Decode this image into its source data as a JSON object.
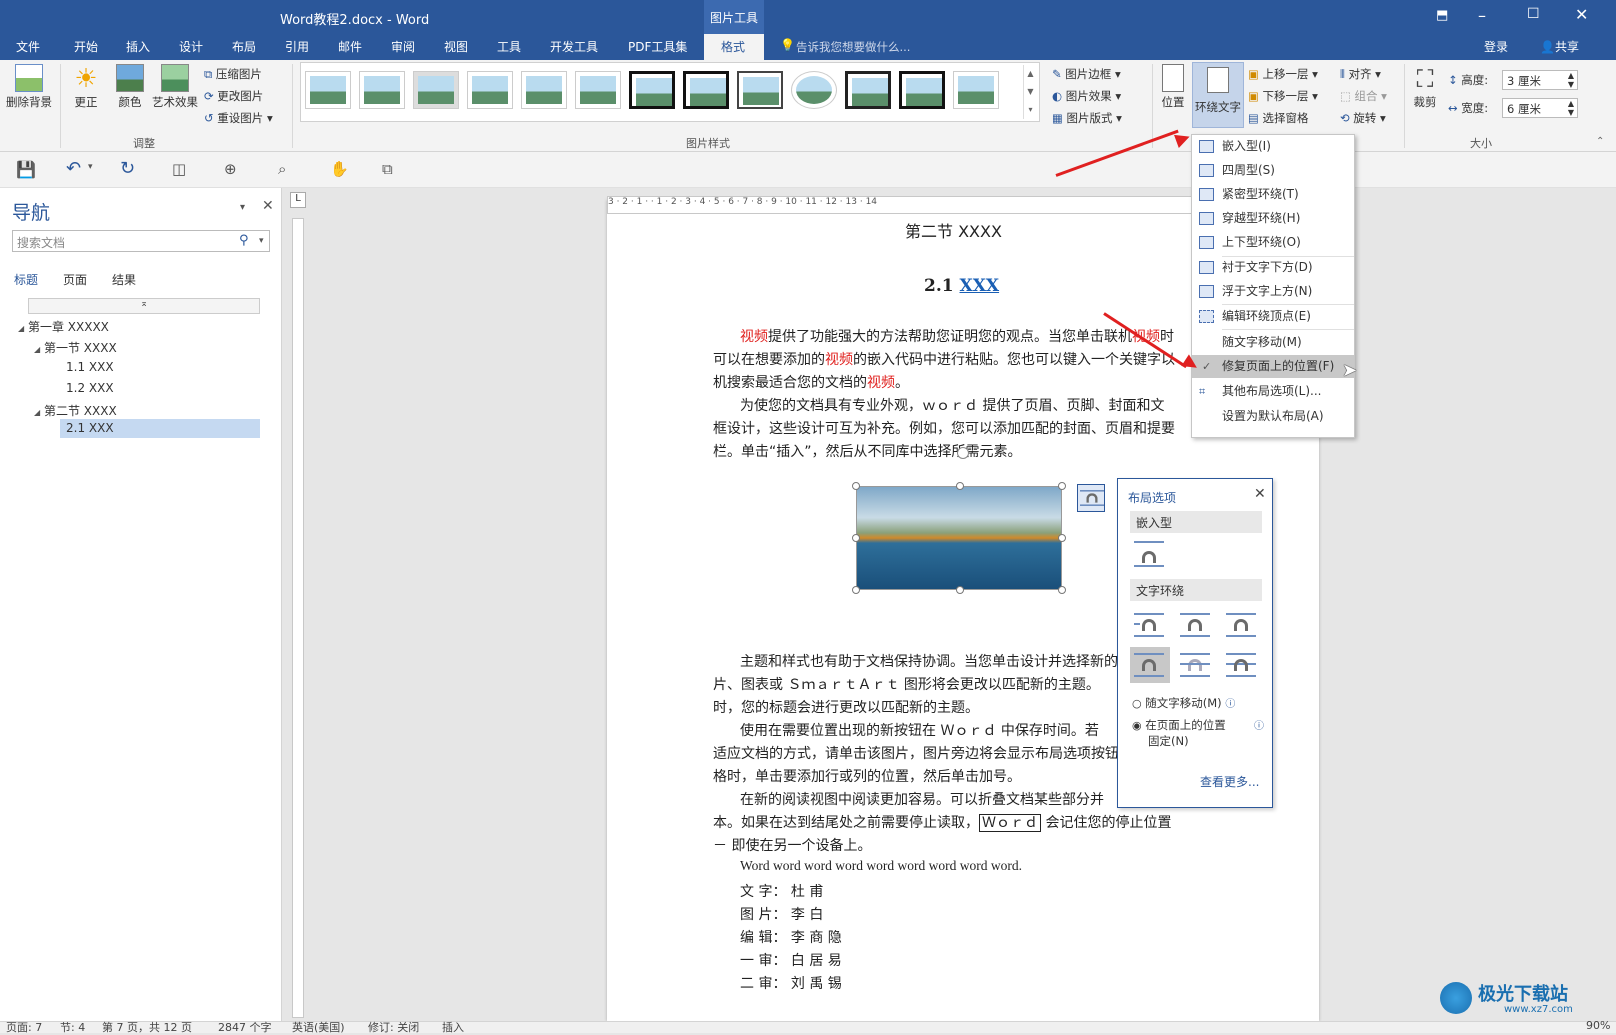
{
  "window": {
    "title": "Word教程2.docx - Word",
    "context_tab_group": "图片工具",
    "login": "登录",
    "share": "共享"
  },
  "tabs": [
    {
      "label": "文件"
    },
    {
      "label": "开始"
    },
    {
      "label": "插入"
    },
    {
      "label": "设计"
    },
    {
      "label": "布局"
    },
    {
      "label": "引用"
    },
    {
      "label": "邮件"
    },
    {
      "label": "审阅"
    },
    {
      "label": "视图"
    },
    {
      "label": "工具"
    },
    {
      "label": "开发工具"
    },
    {
      "label": "PDF工具集"
    },
    {
      "label": "格式"
    }
  ],
  "tellme": "告诉我您想要做什么...",
  "ribbon": {
    "remove_bg": "删除背景",
    "correct": "更正",
    "color": "颜色",
    "artistic": "艺术效果",
    "compress": "压缩图片",
    "change": "更改图片",
    "reset": "重设图片",
    "group_adjust": "调整",
    "group_styles": "图片样式",
    "border": "图片边框",
    "effects": "图片效果",
    "layout": "图片版式",
    "position": "位置",
    "wrap": "环绕文字",
    "bring_forward": "上移一层",
    "send_backward": "下移一层",
    "selection_pane": "选择窗格",
    "align": "对齐",
    "group": "组合",
    "rotate": "旋转",
    "crop": "裁剪",
    "height_label": "高度:",
    "height_value": "3 厘米",
    "width_label": "宽度:",
    "width_value": "6 厘米",
    "group_size": "大小"
  },
  "nav": {
    "title": "导航",
    "search_placeholder": "搜索文档",
    "tabs": [
      "标题",
      "页面",
      "结果"
    ],
    "tree": [
      {
        "label": "第一章 XXXXX"
      },
      {
        "label": "第一节 XXXX"
      },
      {
        "label": "1.1 XXX"
      },
      {
        "label": "1.2 XXX"
      },
      {
        "label": "第二节 XXXX"
      },
      {
        "label": "2.1 XXX"
      }
    ]
  },
  "ruler": "3 · 2 · 1 · · 1 · 2 · 3 · 4 · 5 · 6 · 7 · 8 · 9 · 10 · 11 · 12 · 13 · 14",
  "doc": {
    "heading_top": "第二节  XXXX",
    "heading": "2.1 ",
    "heading_link": "XXX",
    "p1a_1": "视频",
    "p1a_2": "提供了功能强大的方法帮助您证明您的观点。当您单击联机",
    "p1a_3": "视频",
    "p1a_4": "时",
    "p1b_1": "可以在想要添加的",
    "p1b_2": "视频",
    "p1b_3": "的嵌入代码中进行粘贴。您也可以键入一个关键字以",
    "p1c_1": "机搜索最适合您的文档的",
    "p1c_2": "视频",
    "p1c_3": "。",
    "p2a": "为使您的文档具有专业外观，ｗｏｒｄ  提供了页眉、页脚、封面和文",
    "p2b": "框设计，这些设计可互为补充。例如，您可以添加匹配的封面、页眉和提要",
    "p2c": "栏。单击“插入”，然后从不同库中选择所需元素。",
    "p3a": "主题和样式也有助于文档保持协调。当您单击设计并选择新的",
    "p3b": "片、图表或  ＳｍａｒｔＡｒｔ  图形将会更改以匹配新的主题。",
    "p3c": "时，您的标题会进行更改以匹配新的主题。",
    "p4a": "使用在需要位置出现的新按钮在  Ｗｏｒｄ  中保存时间。若",
    "p4b": "适应文档的方式，请单击该图片，图片旁边将会显示布局选项按钮",
    "p4c": "格时，单击要添加行或列的位置，然后单击加号。",
    "p5a": "在新的阅读视图中阅读更加容易。可以折叠文档某些部分并",
    "p5b_1": "本。如果在达到结尾处之前需要停止读取，",
    "p5b_box": "Ｗｏｒｄ",
    "p5b_2": "  会记住您的停止位置",
    "p5c": "－  即使在另一个设备上。",
    "p6": "Word word word word word word word word word.",
    "credits": [
      {
        "k": "文 字：",
        "v": "杜   甫"
      },
      {
        "k": "图 片：",
        "v": "李   白"
      },
      {
        "k": "编 辑：",
        "v": "李 商 隐"
      },
      {
        "k": "一 审：",
        "v": "白 居 易"
      },
      {
        "k": "二 审：",
        "v": "刘 禹 锡"
      }
    ]
  },
  "wrap_menu": [
    {
      "label": "嵌入型(I)"
    },
    {
      "label": "四周型(S)"
    },
    {
      "label": "紧密型环绕(T)"
    },
    {
      "label": "穿越型环绕(H)"
    },
    {
      "label": "上下型环绕(O)"
    },
    {
      "label": "衬于文字下方(D)"
    },
    {
      "label": "浮于文字上方(N)"
    },
    {
      "label": "编辑环绕顶点(E)"
    },
    {
      "label": "随文字移动(M)"
    },
    {
      "label": "修复页面上的位置(F)"
    },
    {
      "label": "其他布局选项(L)..."
    },
    {
      "label": "设置为默认布局(A)"
    }
  ],
  "layout_panel": {
    "title": "布局选项",
    "inline_header": "嵌入型",
    "wrap_header": "文字环绕",
    "move_with_text": "随文字移动(M)",
    "fix_position_1": "在页面上的位置",
    "fix_position_2": "固定(N)",
    "see_more": "查看更多..."
  },
  "status": {
    "page": "页面: 7",
    "section": "节: 4",
    "pages": "第 7 页，共 12 页",
    "words": "2847 个字",
    "lang": "英语(美国)",
    "track": "修订: 关闭",
    "mode": "插入",
    "zoom": "90%"
  },
  "watermark": "极光下载站",
  "watermark_url": "www.xz7.com",
  "colors": {
    "brand": "#2b579a",
    "accent_red": "#e0201e",
    "link": "#1a5fb4"
  }
}
